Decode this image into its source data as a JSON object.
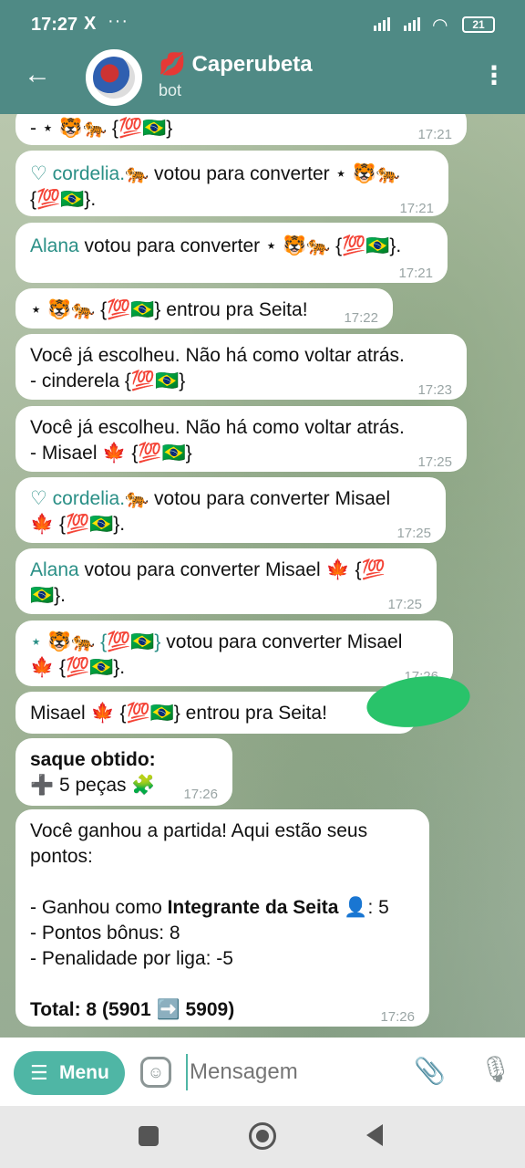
{
  "status": {
    "time": "17:27",
    "x_icon": "X",
    "more_dots": "···",
    "battery": "21"
  },
  "header": {
    "title": "💋 Caperubeta",
    "subtitle": "bot"
  },
  "messages": [
    {
      "text": "- ⋆ 🐯🐅 {💯🇧🇷}",
      "time": "17:21"
    },
    {
      "text_name": "♡ cordelia.🐅",
      "text": " votou para converter ⋆ 🐯🐅",
      "text2": "{💯🇧🇷}.",
      "time": "17:21"
    },
    {
      "text_name": "Alana",
      "text": " votou para converter ⋆ 🐯🐅 {💯🇧🇷}.",
      "time": "17:21"
    },
    {
      "text": "⋆ 🐯🐅 {💯🇧🇷} entrou pra Seita!",
      "time": "17:22"
    },
    {
      "text": "Você já escolheu. Não há como voltar atrás.",
      "text2": "- cinderela {💯🇧🇷}",
      "time": "17:23"
    },
    {
      "text": "Você já escolheu. Não há como voltar atrás.",
      "text2": "- Misael 🍁 {💯🇧🇷}",
      "time": "17:25"
    },
    {
      "text_name": "♡ cordelia.🐅",
      "text": " votou para converter Misael",
      "text2": "🍁 {💯🇧🇷}.",
      "time": "17:25"
    },
    {
      "text_name": "Alana",
      "text": " votou para converter Misael 🍁 {💯",
      "text2": "🇧🇷}.",
      "time": "17:25"
    },
    {
      "text_name": "⋆ 🐯🐅 {💯🇧🇷}",
      "text": " votou para converter Misael",
      "text2": "🍁 {💯🇧🇷}.",
      "time": "17:26"
    },
    {
      "text": "Misael 🍁 {💯🇧🇷} entrou pra Seita!",
      "time": ""
    },
    {
      "bold": "saque obtido:",
      "text": "➕ 5 peças 🧩",
      "time": "17:26"
    },
    {
      "line1": "Você ganhou a partida! Aqui estão seus",
      "line2": "pontos:",
      "line3_pre": "- Ganhou como ",
      "line3_bold": "Integrante da Seita",
      "line3_post": " 👤: 5",
      "line4": "- Pontos bônus: 8",
      "line5": "- Penalidade por liga: -5",
      "total": "Total: 8 (5901 ➡️ 5909)",
      "time": "17:26"
    }
  ],
  "input": {
    "menu_label": "Menu",
    "placeholder": "Mensagem"
  }
}
